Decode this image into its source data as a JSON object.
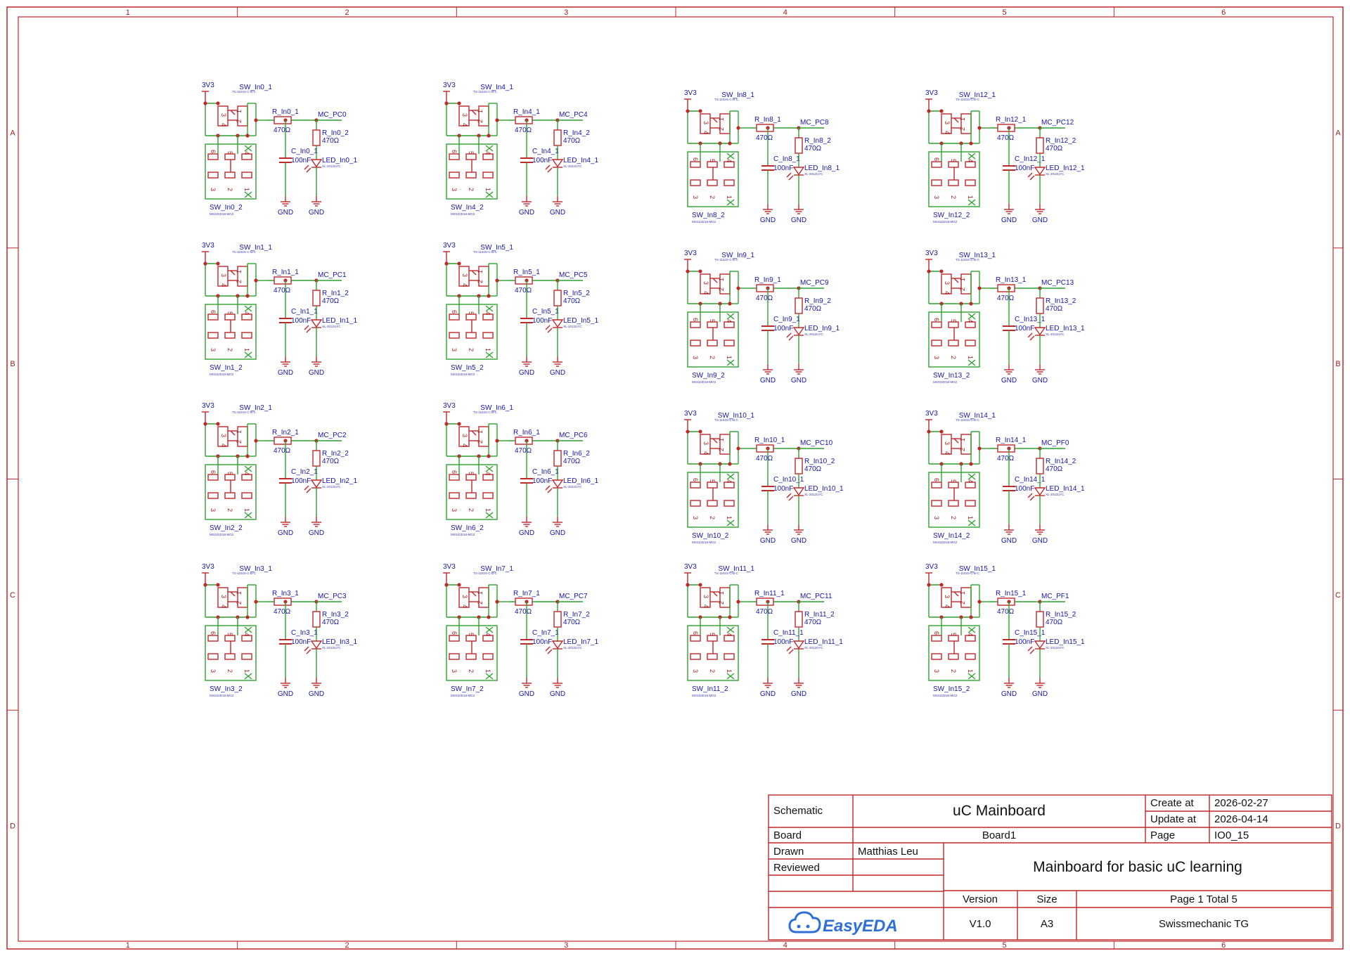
{
  "ruler": {
    "columns": [
      "1",
      "2",
      "3",
      "4",
      "5",
      "6"
    ],
    "rows": [
      "A",
      "B",
      "C",
      "D"
    ]
  },
  "labels": {
    "power": "3V3",
    "ground": "GND",
    "resistor_value": "470Ω",
    "cap_value": "100nF",
    "switch_part": "TS-1102S-C-B-C",
    "switch2_part": "MSS22D18-MG2",
    "led_part": "XL-2012UYC"
  },
  "pins": {
    "p1": "1",
    "p2": "2",
    "p3": "3",
    "p4": "4",
    "p5": "5",
    "p6": "6"
  },
  "channels": [
    {
      "i": 0,
      "net": "MC_PC0"
    },
    {
      "i": 1,
      "net": "MC_PC1"
    },
    {
      "i": 2,
      "net": "MC_PC2"
    },
    {
      "i": 3,
      "net": "MC_PC3"
    },
    {
      "i": 4,
      "net": "MC_PC4"
    },
    {
      "i": 5,
      "net": "MC_PC5"
    },
    {
      "i": 6,
      "net": "MC_PC6"
    },
    {
      "i": 7,
      "net": "MC_PC7"
    },
    {
      "i": 8,
      "net": "MC_PC8"
    },
    {
      "i": 9,
      "net": "MC_PC9"
    },
    {
      "i": 10,
      "net": "MC_PC10"
    },
    {
      "i": 11,
      "net": "MC_PC11"
    },
    {
      "i": 12,
      "net": "MC_PC12"
    },
    {
      "i": 13,
      "net": "MC_PC13"
    },
    {
      "i": 14,
      "net": "MC_PF0"
    },
    {
      "i": 15,
      "net": "MC_PF1"
    }
  ],
  "title_block": {
    "schematic_label": "Schematic",
    "title": "uC Mainboard",
    "create_label": "Create at",
    "create_value": "2026-02-27",
    "update_label": "Update at",
    "update_value": "2026-04-14",
    "board_label": "Board",
    "board_value": "Board1",
    "page_label": "Page",
    "page_value": "IO0_15",
    "drawn_label": "Drawn",
    "drawn_value": "Matthias Leu",
    "reviewed_label": "Reviewed",
    "description": "Mainboard for basic uC learning",
    "version_label": "Version",
    "version_value": "V1.0",
    "size_label": "Size",
    "size_value": "A3",
    "page_count": "Page  1  Total  5",
    "company": "Swissmechanic TG",
    "logo_text": "EasyEDA"
  },
  "colors": {
    "frame": "#c0282a",
    "wire": "#2ea12e",
    "label": "#1616a8",
    "logo": "#2f6fd6"
  }
}
